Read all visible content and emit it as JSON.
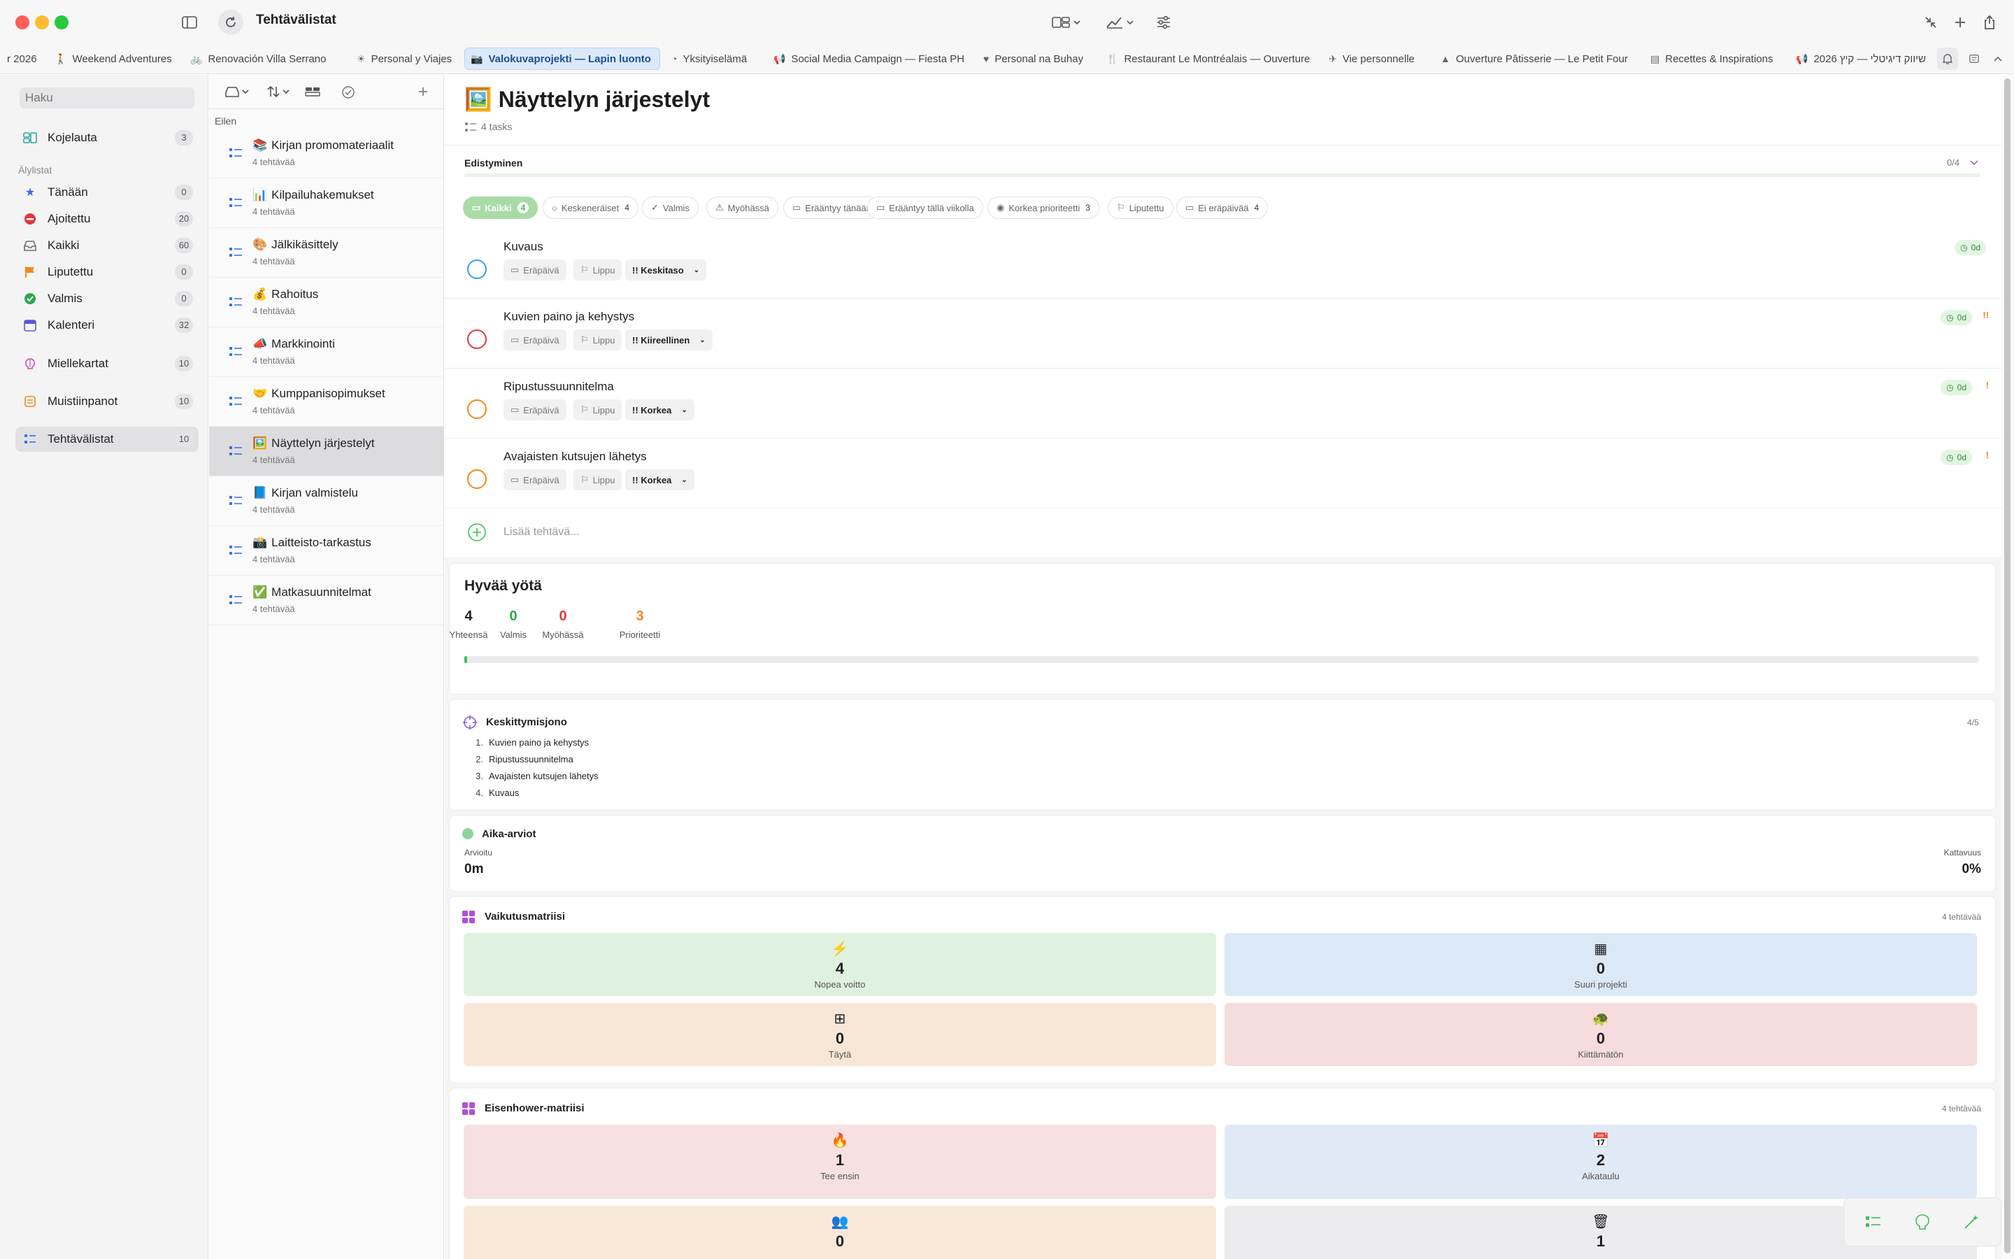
{
  "window": {
    "title": "Tehtävälistat"
  },
  "tabs": [
    {
      "label": "r 2026",
      "icon": ""
    },
    {
      "label": "Weekend Adventures",
      "icon": "🚶"
    },
    {
      "label": "Renovación Villa Serrano",
      "icon": "🚲"
    },
    {
      "label": "Personal y Viajes",
      "icon": "☀"
    },
    {
      "label": "Valokuvaprojekti — Lapin luonto",
      "icon": "📷"
    },
    {
      "label": "Yksityiselämä",
      "icon": "◔"
    },
    {
      "label": "Social Media Campaign — Fiesta PH",
      "icon": "📢"
    },
    {
      "label": "Personal na Buhay",
      "icon": "♥"
    },
    {
      "label": "Restaurant Le Montréalais — Ouverture",
      "icon": "🍴"
    },
    {
      "label": "Vie personnelle",
      "icon": "✈"
    },
    {
      "label": "Ouverture Pâtisserie — Le Petit Four",
      "icon": "▲"
    },
    {
      "label": "Recettes & Inspirations",
      "icon": "▤"
    },
    {
      "label": "שיווק דיגיטלי — קיץ 2026",
      "icon": "📢"
    }
  ],
  "sidebar": {
    "search_placeholder": "Haku",
    "dashboard": {
      "label": "Kojelauta",
      "count": "3"
    },
    "smart_section": "Älylistat",
    "smart": [
      {
        "label": "Tänään",
        "count": "0",
        "color": "#2f6fe0"
      },
      {
        "label": "Ajoitettu",
        "count": "20",
        "color": "#e0393e"
      },
      {
        "label": "Kaikki",
        "count": "60",
        "color": "#6e6e73"
      },
      {
        "label": "Liputettu",
        "count": "0",
        "color": "#f08a1c"
      },
      {
        "label": "Valmis",
        "count": "0",
        "color": "#2ea84a"
      },
      {
        "label": "Kalenteri",
        "count": "32",
        "color": "#5856d6"
      }
    ],
    "mindmaps": {
      "label": "Miellekartat",
      "count": "10"
    },
    "notes": {
      "label": "Muistiinpanot",
      "count": "10"
    },
    "tasklists": {
      "label": "Tehtävälistat",
      "count": "10"
    }
  },
  "list": {
    "group": "Eilen",
    "items": [
      {
        "emoji": "📚",
        "title": "Kirjan promomateriaalit",
        "sub": "4 tehtävää"
      },
      {
        "emoji": "📊",
        "title": "Kilpailuhakemukset",
        "sub": "4 tehtävää"
      },
      {
        "emoji": "🎨",
        "title": "Jälkikäsittely",
        "sub": "4 tehtävää"
      },
      {
        "emoji": "💰",
        "title": "Rahoitus",
        "sub": "4 tehtävää"
      },
      {
        "emoji": "📣",
        "title": "Markkinointi",
        "sub": "4 tehtävää"
      },
      {
        "emoji": "🤝",
        "title": "Kumppanisopimukset",
        "sub": "4 tehtävää"
      },
      {
        "emoji": "🖼️",
        "title": "Näyttelyn järjestelyt",
        "sub": "4 tehtävää"
      },
      {
        "emoji": "📘",
        "title": "Kirjan valmistelu",
        "sub": "4 tehtävää"
      },
      {
        "emoji": "📸",
        "title": "Laitteisto-tarkastus",
        "sub": "4 tehtävää"
      },
      {
        "emoji": "✅",
        "title": "Matkasuunnitelmat",
        "sub": "4 tehtävää"
      }
    ]
  },
  "main": {
    "emoji": "🖼️",
    "title": "Näyttelyn järjestelyt",
    "task_count": "4 tasks",
    "progress": {
      "label": "Edistyminen",
      "value": "0/4",
      "fraction": 0.0
    },
    "filters": [
      {
        "label": "Kaikki",
        "count": "4",
        "icon": "▭"
      },
      {
        "label": "Keskeneräiset",
        "count": "4",
        "icon": "○"
      },
      {
        "label": "Valmis",
        "count": "",
        "icon": "✓"
      },
      {
        "label": "Myöhässä",
        "count": "",
        "icon": "⚠"
      },
      {
        "label": "Erääntyy tänään",
        "count": "",
        "icon": "▭"
      },
      {
        "label": "Erääntyy tällä viikolla",
        "count": "",
        "icon": "▭"
      },
      {
        "label": "Korkea prioriteetti",
        "count": "3",
        "icon": "◉"
      },
      {
        "label": "Liputettu",
        "count": "",
        "icon": "⚐"
      },
      {
        "label": "Ei eräpäivää",
        "count": "4",
        "icon": "▭"
      }
    ],
    "tasks": [
      {
        "title": "Kuvaus",
        "due": "Eräpäivä",
        "flag": "Lippu",
        "priority": "!! Keskitaso",
        "badge": "0d",
        "mark": "",
        "color": "#3a9ee8"
      },
      {
        "title": "Kuvien paino ja kehystys",
        "due": "Eräpäivä",
        "flag": "Lippu",
        "priority": "!! Kiireellinen",
        "badge": "0d",
        "mark": "!!",
        "color": "#e0393e"
      },
      {
        "title": "Ripustussuunnitelma",
        "due": "Eräpäivä",
        "flag": "Lippu",
        "priority": "!! Korkea",
        "badge": "0d",
        "mark": "!",
        "color": "#f08a1c"
      },
      {
        "title": "Avajaisten kutsujen lähetys",
        "due": "Eräpäivä",
        "flag": "Lippu",
        "priority": "!! Korkea",
        "badge": "0d",
        "mark": "!",
        "color": "#f08a1c"
      }
    ],
    "add_task": "Lisää tehtävä..."
  },
  "greeting": {
    "title": "Hyvää yötä",
    "stats": [
      {
        "value": "4",
        "label": "Yhteensä",
        "color": "#222222"
      },
      {
        "value": "0",
        "label": "Valmis",
        "color": "#2ea84a"
      },
      {
        "value": "0",
        "label": "Myöhässä",
        "color": "#e0393e"
      },
      {
        "value": "3",
        "label": "Prioriteetti",
        "color": "#f08a1c"
      }
    ],
    "progress_fraction": 0.0
  },
  "focus": {
    "title": "Keskittymisjono",
    "count": "4/5",
    "items": [
      "1.",
      "Kuvien paino ja kehystys",
      "2.",
      "Ripustussuunnitelma",
      "3.",
      "Avajaisten kutsujen lähetys",
      "4.",
      "Kuvaus"
    ]
  },
  "time": {
    "title": "Aika-arviot",
    "estimated_label": "Arvioitu",
    "estimated_value": "0m",
    "coverage_label": "Kattavuus",
    "coverage_value": "0%"
  },
  "impact": {
    "title": "Vaikutusmatriisi",
    "count": "4 tehtävää",
    "cells": [
      {
        "value": "4",
        "label": "Nopea voitto",
        "icon": "⚡",
        "bg": "#dff2df"
      },
      {
        "value": "0",
        "label": "Suuri projekti",
        "icon": "▦",
        "bg": "#dbe8f6"
      },
      {
        "value": "0",
        "label": "Täytä",
        "icon": "⊞",
        "bg": "#f8e6d6"
      },
      {
        "value": "0",
        "label": "Kiittämätön",
        "icon": "🐢",
        "bg": "#f7dcdd"
      }
    ]
  },
  "eisenhower": {
    "title": "Eisenhower-matriisi",
    "count": "4 tehtävää",
    "cells": [
      {
        "value": "1",
        "label": "Tee ensin",
        "icon": "🔥",
        "bg": "#f7e0e0"
      },
      {
        "value": "2",
        "label": "Aikataulu",
        "icon": "📅",
        "bg": "#e0e9f6"
      },
      {
        "value": "0",
        "label": "",
        "icon": "👥",
        "bg": "#f8e8d8"
      },
      {
        "value": "1",
        "label": "",
        "icon": "🗑",
        "bg": "#ececee"
      }
    ]
  }
}
